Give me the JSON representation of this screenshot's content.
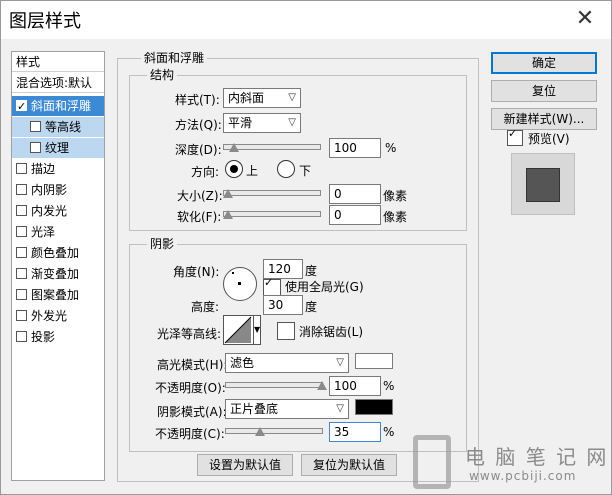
{
  "window": {
    "title": "图层样式",
    "close_icon": "close-icon"
  },
  "styles_panel": {
    "header": "样式",
    "blend_default": "混合选项:默认",
    "items": [
      {
        "label": "斜面和浮雕",
        "checked": true,
        "selected": true,
        "sub": false
      },
      {
        "label": "等高线",
        "checked": false,
        "selected": false,
        "sub": true
      },
      {
        "label": "纹理",
        "checked": false,
        "selected": false,
        "sub": true
      },
      {
        "label": "描边",
        "checked": false,
        "selected": false,
        "sub": false
      },
      {
        "label": "内阴影",
        "checked": false,
        "selected": false,
        "sub": false
      },
      {
        "label": "内发光",
        "checked": false,
        "selected": false,
        "sub": false
      },
      {
        "label": "光泽",
        "checked": false,
        "selected": false,
        "sub": false
      },
      {
        "label": "颜色叠加",
        "checked": false,
        "selected": false,
        "sub": false
      },
      {
        "label": "渐变叠加",
        "checked": false,
        "selected": false,
        "sub": false
      },
      {
        "label": "图案叠加",
        "checked": false,
        "selected": false,
        "sub": false
      },
      {
        "label": "外发光",
        "checked": false,
        "selected": false,
        "sub": false
      },
      {
        "label": "投影",
        "checked": false,
        "selected": false,
        "sub": false
      }
    ]
  },
  "bevel": {
    "title": "斜面和浮雕",
    "structure": {
      "title": "结构",
      "style_label": "样式(T):",
      "style_value": "内斜面",
      "technique_label": "方法(Q):",
      "technique_value": "平滑",
      "depth_label": "深度(D):",
      "depth_value": "100",
      "depth_unit": "%",
      "depth_fraction": 0.1,
      "direction_label": "方向:",
      "direction_up": "上",
      "direction_down": "下",
      "size_label": "大小(Z):",
      "size_value": "0",
      "size_unit": "像素",
      "soften_label": "软化(F):",
      "soften_value": "0",
      "soften_unit": "像素"
    },
    "shading": {
      "title": "阴影",
      "angle_label": "角度(N):",
      "angle_value": "120",
      "angle_unit": "度",
      "global_light_label": "使用全局光(G)",
      "global_light_checked": true,
      "altitude_label": "高度:",
      "altitude_value": "30",
      "altitude_unit": "度",
      "gloss_contour_label": "光泽等高线:",
      "anti_alias_label": "消除锯齿(L)",
      "anti_alias_checked": false,
      "highlight_mode_label": "高光模式(H):",
      "highlight_mode_value": "滤色",
      "highlight_color": "#ffffff",
      "highlight_opacity_label": "不透明度(O):",
      "highlight_opacity_value": "100",
      "highlight_opacity_unit": "%",
      "highlight_opacity_fraction": 1.0,
      "shadow_mode_label": "阴影模式(A):",
      "shadow_mode_value": "正片叠底",
      "shadow_color": "#000000",
      "shadow_opacity_label": "不透明度(C):",
      "shadow_opacity_value": "35",
      "shadow_opacity_unit": "%",
      "shadow_opacity_fraction": 0.35
    },
    "set_default_label": "设置为默认值",
    "reset_default_label": "复位为默认值"
  },
  "buttons": {
    "ok": "确定",
    "reset": "复位",
    "new_style": "新建样式(W)...",
    "preview_label": "预览(V)",
    "preview_checked": true
  },
  "preview_swatch_color": "#555555",
  "watermark": {
    "text_cn": "电 脑 笔 记 网",
    "text_url": "www.pcbiji.com"
  }
}
